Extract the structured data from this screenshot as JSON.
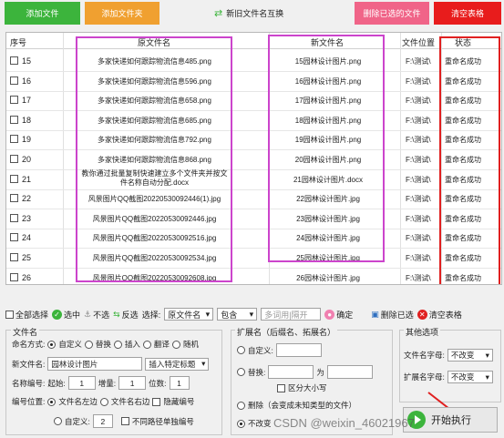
{
  "toolbar": {
    "add_file": "添加文件",
    "add_folder": "添加文件夹",
    "swap_label": "新旧文件名互换",
    "delete_selected": "删除已选的文件",
    "clear_table": "清空表格"
  },
  "table": {
    "columns": [
      "序号",
      "原文件名",
      "新文件名",
      "文件位置",
      "状态"
    ],
    "rows": [
      {
        "num": "15",
        "orig": "多家快递如何跟踪物流信息485.png",
        "new": "15园林设计图片.png",
        "loc": "F:\\测试\\",
        "status": "重命名成功"
      },
      {
        "num": "16",
        "orig": "多家快递如何跟踪物流信息596.png",
        "new": "16园林设计图片.png",
        "loc": "F:\\测试\\",
        "status": "重命名成功"
      },
      {
        "num": "17",
        "orig": "多家快递如何跟踪物流信息658.png",
        "new": "17园林设计图片.png",
        "loc": "F:\\测试\\",
        "status": "重命名成功"
      },
      {
        "num": "18",
        "orig": "多家快递如何跟踪物流信息685.png",
        "new": "18园林设计图片.png",
        "loc": "F:\\测试\\",
        "status": "重命名成功"
      },
      {
        "num": "19",
        "orig": "多家快递如何跟踪物流信息792.png",
        "new": "19园林设计图片.png",
        "loc": "F:\\测试\\",
        "status": "重命名成功"
      },
      {
        "num": "20",
        "orig": "多家快递如何跟踪物流信息868.png",
        "new": "20园林设计图片.png",
        "loc": "F:\\测试\\",
        "status": "重命名成功"
      },
      {
        "num": "21",
        "orig": "教你通过批量复制快速建立多个文件夹并按文件名称自动分配.docx",
        "new": "21园林设计图片.docx",
        "loc": "F:\\测试\\",
        "status": "重命名成功"
      },
      {
        "num": "22",
        "orig": "风景图片QQ截图20220530092446(1).jpg",
        "new": "22园林设计图片.jpg",
        "loc": "F:\\测试\\",
        "status": "重命名成功"
      },
      {
        "num": "23",
        "orig": "风景图片QQ截图20220530092446.jpg",
        "new": "23园林设计图片.jpg",
        "loc": "F:\\测试\\",
        "status": "重命名成功"
      },
      {
        "num": "24",
        "orig": "风景图片QQ截图20220530092516.jpg",
        "new": "24园林设计图片.jpg",
        "loc": "F:\\测试\\",
        "status": "重命名成功"
      },
      {
        "num": "25",
        "orig": "风景图片QQ截图20220530092534.jpg",
        "new": "25园林设计图片.jpg",
        "loc": "F:\\测试\\",
        "status": "重命名成功"
      },
      {
        "num": "26",
        "orig": "风景图片QQ截图20220530092608.jpg",
        "new": "26园林设计图片.jpg",
        "loc": "F:\\测试\\",
        "status": "重命名成功"
      }
    ]
  },
  "filter": {
    "select_all": "全部选择",
    "select": "选中",
    "unselect": "不选",
    "invert": "反选",
    "choose": "选择:",
    "field_value": "原文件名",
    "match_value": "包含",
    "keyword_placeholder": "多词用|隔开",
    "confirm": "确定",
    "delete_selected": "删除已选",
    "clear_table": "清空表格"
  },
  "filename_panel": {
    "title": "文件名",
    "naming_label": "命名方式:",
    "naming_options": [
      "自定义",
      "替换",
      "插入",
      "翻译",
      "随机"
    ],
    "newname_label": "新文件名:",
    "newname_value": "园林设计图片",
    "insert_select": "插入特定标题",
    "numbering_label": "名称编号:",
    "start_label": "起始:",
    "start_value": "1",
    "increment_label": "增量:",
    "increment_value": "1",
    "digits_label": "位数:",
    "digits_value": "1",
    "position_label": "编号位置:",
    "pos_left": "文件名左边",
    "pos_right": "文件名右边",
    "hide_number": "隐藏编号",
    "custom": "自定义:",
    "custom_value": "2",
    "different_path": "不同路径单独编号"
  },
  "ext_panel": {
    "title": "扩展名（后缀名、拓展名）",
    "custom": "自定义:",
    "replace": "替换:",
    "as": "为",
    "case_sensitive": "区分大小写",
    "delete_note": "删除（会变成未知类型的文件）",
    "unchanged": "不改变"
  },
  "other_panel": {
    "title": "其他选项",
    "filename_case_label": "文件名字母:",
    "filename_case_value": "不改变",
    "ext_case_label": "扩展名字母:",
    "ext_case_value": "不改变"
  },
  "start_button": "开始执行",
  "watermark": "CSDN @weixin_46021967"
}
